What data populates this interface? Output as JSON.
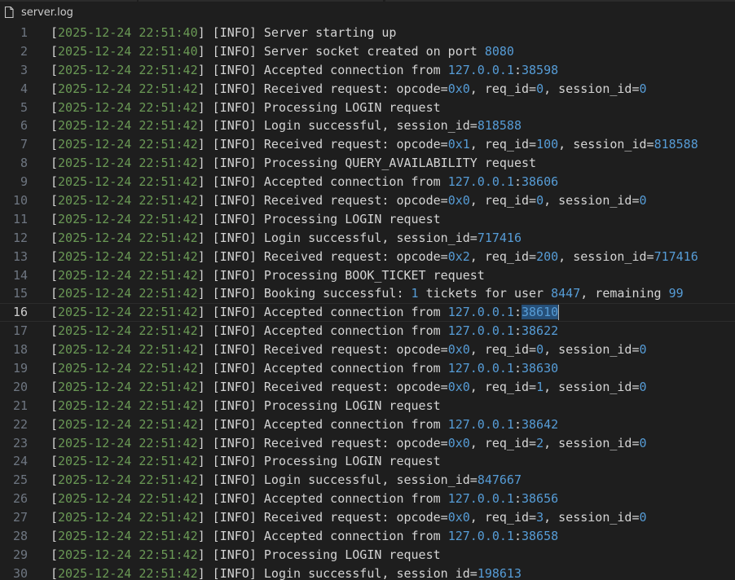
{
  "tab": {
    "filename": "server.log",
    "icon": "file-icon"
  },
  "current_line": 16,
  "lines": [
    {
      "n": "1",
      "ts": "2025-12-24 22:51:40",
      "level": "INFO",
      "parts": [
        {
          "t": "Server starting up"
        }
      ]
    },
    {
      "n": "2",
      "ts": "2025-12-24 22:51:40",
      "level": "INFO",
      "parts": [
        {
          "t": "Server socket created on port "
        },
        {
          "t": "8080",
          "c": "num"
        }
      ]
    },
    {
      "n": "3",
      "ts": "2025-12-24 22:51:42",
      "level": "INFO",
      "parts": [
        {
          "t": "Accepted connection from "
        },
        {
          "t": "127.0.0.1",
          "c": "num"
        },
        {
          "t": ":"
        },
        {
          "t": "38598",
          "c": "num"
        }
      ]
    },
    {
      "n": "4",
      "ts": "2025-12-24 22:51:42",
      "level": "INFO",
      "parts": [
        {
          "t": "Received request: opcode="
        },
        {
          "t": "0x0",
          "c": "num"
        },
        {
          "t": ", req_id="
        },
        {
          "t": "0",
          "c": "num"
        },
        {
          "t": ", session_id="
        },
        {
          "t": "0",
          "c": "num"
        }
      ]
    },
    {
      "n": "5",
      "ts": "2025-12-24 22:51:42",
      "level": "INFO",
      "parts": [
        {
          "t": "Processing LOGIN request"
        }
      ]
    },
    {
      "n": "6",
      "ts": "2025-12-24 22:51:42",
      "level": "INFO",
      "parts": [
        {
          "t": "Login successful, session_id="
        },
        {
          "t": "818588",
          "c": "num"
        }
      ]
    },
    {
      "n": "7",
      "ts": "2025-12-24 22:51:42",
      "level": "INFO",
      "parts": [
        {
          "t": "Received request: opcode="
        },
        {
          "t": "0x1",
          "c": "num"
        },
        {
          "t": ", req_id="
        },
        {
          "t": "100",
          "c": "num"
        },
        {
          "t": ", session_id="
        },
        {
          "t": "818588",
          "c": "num"
        }
      ]
    },
    {
      "n": "8",
      "ts": "2025-12-24 22:51:42",
      "level": "INFO",
      "parts": [
        {
          "t": "Processing QUERY_AVAILABILITY request"
        }
      ]
    },
    {
      "n": "9",
      "ts": "2025-12-24 22:51:42",
      "level": "INFO",
      "parts": [
        {
          "t": "Accepted connection from "
        },
        {
          "t": "127.0.0.1",
          "c": "num"
        },
        {
          "t": ":"
        },
        {
          "t": "38606",
          "c": "num"
        }
      ]
    },
    {
      "n": "10",
      "ts": "2025-12-24 22:51:42",
      "level": "INFO",
      "parts": [
        {
          "t": "Received request: opcode="
        },
        {
          "t": "0x0",
          "c": "num"
        },
        {
          "t": ", req_id="
        },
        {
          "t": "0",
          "c": "num"
        },
        {
          "t": ", session_id="
        },
        {
          "t": "0",
          "c": "num"
        }
      ]
    },
    {
      "n": "11",
      "ts": "2025-12-24 22:51:42",
      "level": "INFO",
      "parts": [
        {
          "t": "Processing LOGIN request"
        }
      ]
    },
    {
      "n": "12",
      "ts": "2025-12-24 22:51:42",
      "level": "INFO",
      "parts": [
        {
          "t": "Login successful, session_id="
        },
        {
          "t": "717416",
          "c": "num"
        }
      ]
    },
    {
      "n": "13",
      "ts": "2025-12-24 22:51:42",
      "level": "INFO",
      "parts": [
        {
          "t": "Received request: opcode="
        },
        {
          "t": "0x2",
          "c": "num"
        },
        {
          "t": ", req_id="
        },
        {
          "t": "200",
          "c": "num"
        },
        {
          "t": ", session_id="
        },
        {
          "t": "717416",
          "c": "num"
        }
      ]
    },
    {
      "n": "14",
      "ts": "2025-12-24 22:51:42",
      "level": "INFO",
      "parts": [
        {
          "t": "Processing BOOK_TICKET request"
        }
      ]
    },
    {
      "n": "15",
      "ts": "2025-12-24 22:51:42",
      "level": "INFO",
      "parts": [
        {
          "t": "Booking successful: "
        },
        {
          "t": "1",
          "c": "num"
        },
        {
          "t": " tickets for user "
        },
        {
          "t": "8447",
          "c": "num"
        },
        {
          "t": ", remaining "
        },
        {
          "t": "99",
          "c": "num"
        }
      ]
    },
    {
      "n": "16",
      "ts": "2025-12-24 22:51:42",
      "level": "INFO",
      "parts": [
        {
          "t": "Accepted connection from "
        },
        {
          "t": "127.0.0.1",
          "c": "num"
        },
        {
          "t": ":"
        },
        {
          "t": "38610",
          "c": "num sel"
        },
        {
          "cursor": true
        }
      ]
    },
    {
      "n": "17",
      "ts": "2025-12-24 22:51:42",
      "level": "INFO",
      "parts": [
        {
          "t": "Accepted connection from "
        },
        {
          "t": "127.0.0.1",
          "c": "num"
        },
        {
          "t": ":"
        },
        {
          "t": "38622",
          "c": "num"
        }
      ]
    },
    {
      "n": "18",
      "ts": "2025-12-24 22:51:42",
      "level": "INFO",
      "parts": [
        {
          "t": "Received request: opcode="
        },
        {
          "t": "0x0",
          "c": "num"
        },
        {
          "t": ", req_id="
        },
        {
          "t": "0",
          "c": "num"
        },
        {
          "t": ", session_id="
        },
        {
          "t": "0",
          "c": "num"
        }
      ]
    },
    {
      "n": "19",
      "ts": "2025-12-24 22:51:42",
      "level": "INFO",
      "parts": [
        {
          "t": "Accepted connection from "
        },
        {
          "t": "127.0.0.1",
          "c": "num"
        },
        {
          "t": ":"
        },
        {
          "t": "38630",
          "c": "num"
        }
      ]
    },
    {
      "n": "20",
      "ts": "2025-12-24 22:51:42",
      "level": "INFO",
      "parts": [
        {
          "t": "Received request: opcode="
        },
        {
          "t": "0x0",
          "c": "num"
        },
        {
          "t": ", req_id="
        },
        {
          "t": "1",
          "c": "num"
        },
        {
          "t": ", session_id="
        },
        {
          "t": "0",
          "c": "num"
        }
      ]
    },
    {
      "n": "21",
      "ts": "2025-12-24 22:51:42",
      "level": "INFO",
      "parts": [
        {
          "t": "Processing LOGIN request"
        }
      ]
    },
    {
      "n": "22",
      "ts": "2025-12-24 22:51:42",
      "level": "INFO",
      "parts": [
        {
          "t": "Accepted connection from "
        },
        {
          "t": "127.0.0.1",
          "c": "num"
        },
        {
          "t": ":"
        },
        {
          "t": "38642",
          "c": "num"
        }
      ]
    },
    {
      "n": "23",
      "ts": "2025-12-24 22:51:42",
      "level": "INFO",
      "parts": [
        {
          "t": "Received request: opcode="
        },
        {
          "t": "0x0",
          "c": "num"
        },
        {
          "t": ", req_id="
        },
        {
          "t": "2",
          "c": "num"
        },
        {
          "t": ", session_id="
        },
        {
          "t": "0",
          "c": "num"
        }
      ]
    },
    {
      "n": "24",
      "ts": "2025-12-24 22:51:42",
      "level": "INFO",
      "parts": [
        {
          "t": "Processing LOGIN request"
        }
      ]
    },
    {
      "n": "25",
      "ts": "2025-12-24 22:51:42",
      "level": "INFO",
      "parts": [
        {
          "t": "Login successful, session_id="
        },
        {
          "t": "847667",
          "c": "num"
        }
      ]
    },
    {
      "n": "26",
      "ts": "2025-12-24 22:51:42",
      "level": "INFO",
      "parts": [
        {
          "t": "Accepted connection from "
        },
        {
          "t": "127.0.0.1",
          "c": "num"
        },
        {
          "t": ":"
        },
        {
          "t": "38656",
          "c": "num"
        }
      ]
    },
    {
      "n": "27",
      "ts": "2025-12-24 22:51:42",
      "level": "INFO",
      "parts": [
        {
          "t": "Received request: opcode="
        },
        {
          "t": "0x0",
          "c": "num"
        },
        {
          "t": ", req_id="
        },
        {
          "t": "3",
          "c": "num"
        },
        {
          "t": ", session_id="
        },
        {
          "t": "0",
          "c": "num"
        }
      ]
    },
    {
      "n": "28",
      "ts": "2025-12-24 22:51:42",
      "level": "INFO",
      "parts": [
        {
          "t": "Accepted connection from "
        },
        {
          "t": "127.0.0.1",
          "c": "num"
        },
        {
          "t": ":"
        },
        {
          "t": "38658",
          "c": "num"
        }
      ]
    },
    {
      "n": "29",
      "ts": "2025-12-24 22:51:42",
      "level": "INFO",
      "parts": [
        {
          "t": "Processing LOGIN request"
        }
      ]
    },
    {
      "n": "30",
      "ts": "2025-12-24 22:51:42",
      "level": "INFO",
      "parts": [
        {
          "t": "Login successful, session_id="
        },
        {
          "t": "198613",
          "c": "num"
        }
      ]
    }
  ]
}
